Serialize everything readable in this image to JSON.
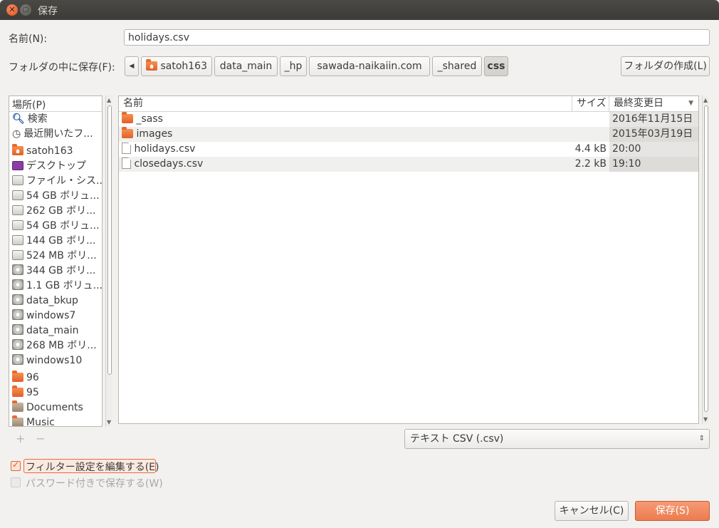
{
  "window": {
    "title": "保存"
  },
  "name_row": {
    "label": "名前(N):",
    "value": "holidays.csv"
  },
  "folder_row": {
    "label": "フォルダの中に保存(F):",
    "breadcrumbs": [
      "satoh163",
      "data_main",
      "_hp",
      "sawada-naikaiin.com",
      "_shared",
      "css"
    ],
    "create_folder": "フォルダの作成(L)"
  },
  "places": {
    "header": "場所(P)",
    "items": [
      {
        "label": "検索",
        "icon": "search-icon"
      },
      {
        "label": "最近開いたフ...",
        "icon": "recent-icon"
      },
      {
        "label": "satoh163",
        "icon": "home-folder-icon"
      },
      {
        "label": "デスクトップ",
        "icon": "desktop-icon"
      },
      {
        "label": "ファイル・シス...",
        "icon": "filesystem-icon"
      },
      {
        "label": "54 GB ボリュ...",
        "icon": "drive-icon"
      },
      {
        "label": "262 GB ボリ...",
        "icon": "drive-icon"
      },
      {
        "label": "54 GB ボリュ...",
        "icon": "drive-icon"
      },
      {
        "label": "144 GB ボリ...",
        "icon": "drive-icon"
      },
      {
        "label": "524 MB ボリ...",
        "icon": "usb-drive-icon"
      },
      {
        "label": "344 GB ボリ...",
        "icon": "disk-icon"
      },
      {
        "label": "1.1 GB ボリュ...",
        "icon": "disk-icon"
      },
      {
        "label": "data_bkup",
        "icon": "disk-icon"
      },
      {
        "label": "windows7",
        "icon": "disk-icon"
      },
      {
        "label": "data_main",
        "icon": "disk-icon"
      },
      {
        "label": "268 MB ボリ...",
        "icon": "disk-icon"
      },
      {
        "label": "windows10",
        "icon": "disk-icon"
      },
      {
        "label": "96",
        "icon": "folder-icon"
      },
      {
        "label": "95",
        "icon": "folder-icon"
      },
      {
        "label": "Documents",
        "icon": "documents-folder-icon"
      },
      {
        "label": "Music",
        "icon": "music-folder-icon"
      }
    ],
    "add": "+",
    "remove": "−"
  },
  "file_list": {
    "columns": {
      "name": "名前",
      "size": "サイズ",
      "modified": "最終変更日"
    },
    "rows": [
      {
        "name": "_sass",
        "size": "",
        "modified": "2016年11月15日",
        "icon": "folder-icon"
      },
      {
        "name": "images",
        "size": "",
        "modified": "2015年03月19日",
        "icon": "folder-icon"
      },
      {
        "name": "holidays.csv",
        "size": "4.4 kB",
        "modified": "20:00",
        "icon": "file-icon"
      },
      {
        "name": "closedays.csv",
        "size": "2.2 kB",
        "modified": "19:10",
        "icon": "file-icon"
      }
    ]
  },
  "filter": {
    "selected": "テキスト CSV (.csv)"
  },
  "options": {
    "edit_filter": "フィルター設定を編集する(E)",
    "password": "パスワード付きで保存する(W)"
  },
  "buttons": {
    "cancel": "キャンセル(C)",
    "save": "保存(S)"
  }
}
